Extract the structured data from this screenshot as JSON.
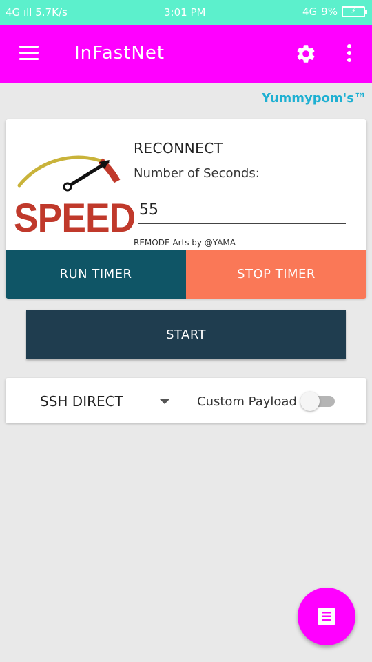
{
  "status_bar": {
    "network": "4G",
    "speed": "5.7K/s",
    "time": "3:01 PM",
    "network_right": "4G",
    "battery_percent": "9%"
  },
  "toolbar": {
    "title": "InFastNet",
    "menu_icon": "hamburger-menu-icon",
    "settings_icon": "gear-icon",
    "overflow_icon": "overflow-menu-icon",
    "color": "#ff00ff"
  },
  "brand": "Yummypom's™",
  "reconnect_card": {
    "speed_logo_text": "SPEED",
    "title": "RECONNECT",
    "seconds_label": "Number of Seconds:",
    "seconds_value": "55",
    "credit": "REMODE Arts by @YAMA",
    "run_label": "RUN TIMER",
    "stop_label": "STOP TIMER",
    "run_color": "#0f5566",
    "stop_color": "#fa7857"
  },
  "start_button": {
    "label": "START",
    "color": "#1f3d4f"
  },
  "mode_card": {
    "selected_mode": "SSH DIRECT",
    "payload_label": "Custom Payload",
    "custom_payload_enabled": false
  },
  "fab": {
    "icon": "log-list-icon",
    "color": "#ff00ff"
  }
}
